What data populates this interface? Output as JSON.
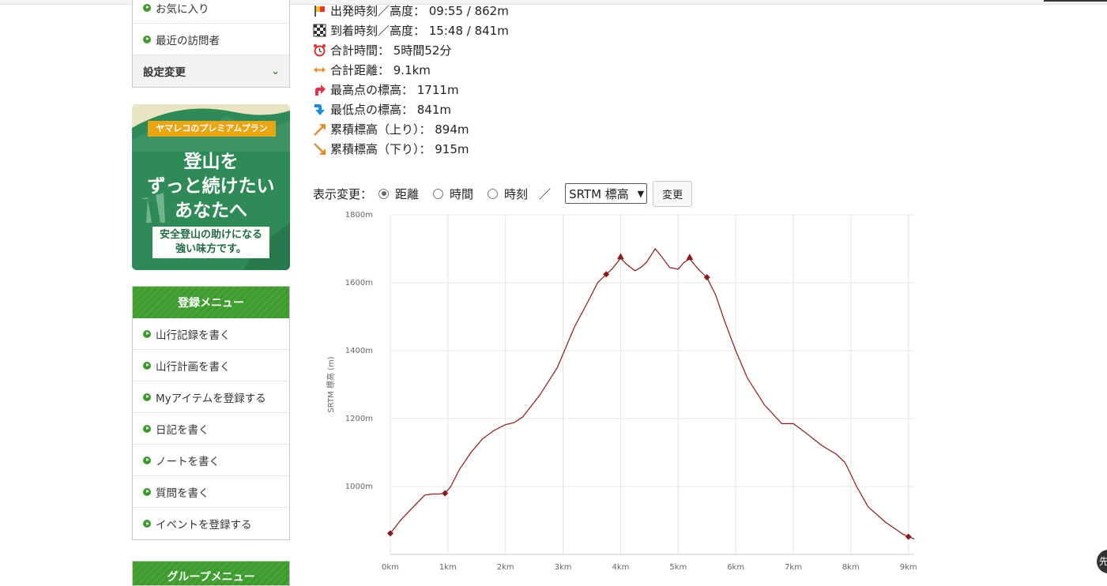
{
  "sidebar": {
    "top_items": [
      {
        "label": "お気に入り"
      },
      {
        "label": "最近の訪問者"
      }
    ],
    "settings_label": "設定変更",
    "banner": {
      "ribbon": "ヤマレコのプレミアムプラン",
      "line1": "登山を",
      "line2": "ずっと続けたい",
      "line3": "あなたへ",
      "sub1": "安全登山の助けになる",
      "sub2": "強い味方です。"
    },
    "register_menu": {
      "title": "登録メニュー",
      "items": [
        {
          "label": "山行記録を書く"
        },
        {
          "label": "山行計画を書く"
        },
        {
          "label": "Myアイテムを登録する"
        },
        {
          "label": "日記を書く"
        },
        {
          "label": "ノートを書く"
        },
        {
          "label": "質問を書く"
        },
        {
          "label": "イベントを登録する"
        }
      ]
    },
    "group_menu_title": "グループメニュー"
  },
  "stats": [
    {
      "icon": "start-flag-icon",
      "color": "#d33",
      "text": "出発時刻／高度： 09:55 / 862m"
    },
    {
      "icon": "goal-flag-icon",
      "color": "#333",
      "text": "到着時刻／高度： 15:48 / 841m"
    },
    {
      "icon": "alarm-clock-icon",
      "color": "#d33",
      "text": "合計時間： 5時間52分"
    },
    {
      "icon": "distance-arrow-icon",
      "color": "#f08a1c",
      "text": "合計距離： 9.1km"
    },
    {
      "icon": "highest-point-icon",
      "color": "#e0334a",
      "text": "最高点の標高： 1711m"
    },
    {
      "icon": "lowest-point-icon",
      "color": "#1a8fd6",
      "text": "最低点の標高： 841m"
    },
    {
      "icon": "ascent-arrow-icon",
      "color": "#e0902a",
      "text": "累積標高（上り）： 894m"
    },
    {
      "icon": "descent-arrow-icon",
      "color": "#e0902a",
      "text": "累積標高（下り）： 915m"
    }
  ],
  "controls": {
    "label": "表示変更：",
    "options": [
      {
        "label": "距離",
        "selected": true
      },
      {
        "label": "時間",
        "selected": false
      },
      {
        "label": "時刻",
        "selected": false
      }
    ],
    "separator": "／",
    "select_value": "SRTM 標高",
    "button_label": "変更"
  },
  "chart_data": {
    "type": "line",
    "ylabel": "SRTM 標高 (m)",
    "xlim": [
      0,
      9.1
    ],
    "ylim": [
      800,
      1800
    ],
    "xticks": [
      0,
      1,
      2,
      3,
      4,
      5,
      6,
      7,
      8,
      9
    ],
    "xtick_labels": [
      "0km",
      "1km",
      "2km",
      "3km",
      "4km",
      "5km",
      "6km",
      "7km",
      "8km",
      "9km"
    ],
    "yticks": [
      1000,
      1200,
      1400,
      1600,
      1800
    ],
    "ytick_labels": [
      "1000m",
      "1200m",
      "1400m",
      "1600m",
      "1800m"
    ],
    "grid": true,
    "line_color": "#8b1a1a",
    "series": [
      {
        "x": [
          0,
          0.2,
          0.4,
          0.6,
          0.75,
          0.85,
          0.95,
          1.05,
          1.2,
          1.4,
          1.6,
          1.8,
          2.0,
          2.15,
          2.3,
          2.6,
          2.9,
          3.2,
          3.45,
          3.6,
          3.75,
          3.85,
          4.0,
          4.1,
          4.25,
          4.35,
          4.45,
          4.6,
          4.7,
          4.85,
          5.0,
          5.1,
          5.2,
          5.35,
          5.5,
          5.65,
          5.8,
          6.0,
          6.2,
          6.5,
          6.8,
          7.0,
          7.2,
          7.5,
          7.75,
          7.9,
          8.1,
          8.3,
          8.6,
          8.9,
          9.1
        ],
        "y": [
          862,
          905,
          940,
          975,
          978,
          978,
          980,
          1000,
          1050,
          1100,
          1140,
          1165,
          1182,
          1188,
          1205,
          1270,
          1350,
          1470,
          1550,
          1600,
          1625,
          1640,
          1672,
          1655,
          1635,
          1645,
          1660,
          1700,
          1680,
          1645,
          1640,
          1660,
          1670,
          1640,
          1615,
          1565,
          1490,
          1400,
          1320,
          1240,
          1185,
          1185,
          1160,
          1120,
          1095,
          1070,
          1000,
          940,
          895,
          860,
          845
        ]
      }
    ],
    "markers": [
      {
        "x": 0,
        "y": 862,
        "shape": "diamond"
      },
      {
        "x": 0.95,
        "y": 980,
        "shape": "diamond"
      },
      {
        "x": 3.75,
        "y": 1625,
        "shape": "diamond"
      },
      {
        "x": 4.0,
        "y": 1676,
        "shape": "triangle"
      },
      {
        "x": 5.2,
        "y": 1674,
        "shape": "triangle"
      },
      {
        "x": 5.5,
        "y": 1616,
        "shape": "diamond"
      },
      {
        "x": 9.0,
        "y": 852,
        "shape": "diamond"
      }
    ]
  },
  "fab_label": "先"
}
